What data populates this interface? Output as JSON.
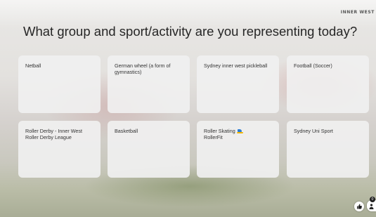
{
  "header": {
    "brand": "INNER WEST"
  },
  "question": "What group and sport/activity are you representing today?",
  "options": [
    {
      "label": "Netball"
    },
    {
      "label": "German wheel (a form of gymnastics)"
    },
    {
      "label": "Sydney inner west pickleball"
    },
    {
      "label": "Football (Soccer)"
    },
    {
      "label": "Roller Derby - Inner West Roller Derby League"
    },
    {
      "label": "Basketball"
    },
    {
      "label": "Roller Skating",
      "label_suffix": "RollerFit",
      "icon": "roller-skate-icon"
    },
    {
      "label": "Sydney Uni Sport"
    }
  ],
  "footer": {
    "reaction_icon": "thumbs-up-icon",
    "participants_icon": "person-icon",
    "participant_count": "0"
  }
}
